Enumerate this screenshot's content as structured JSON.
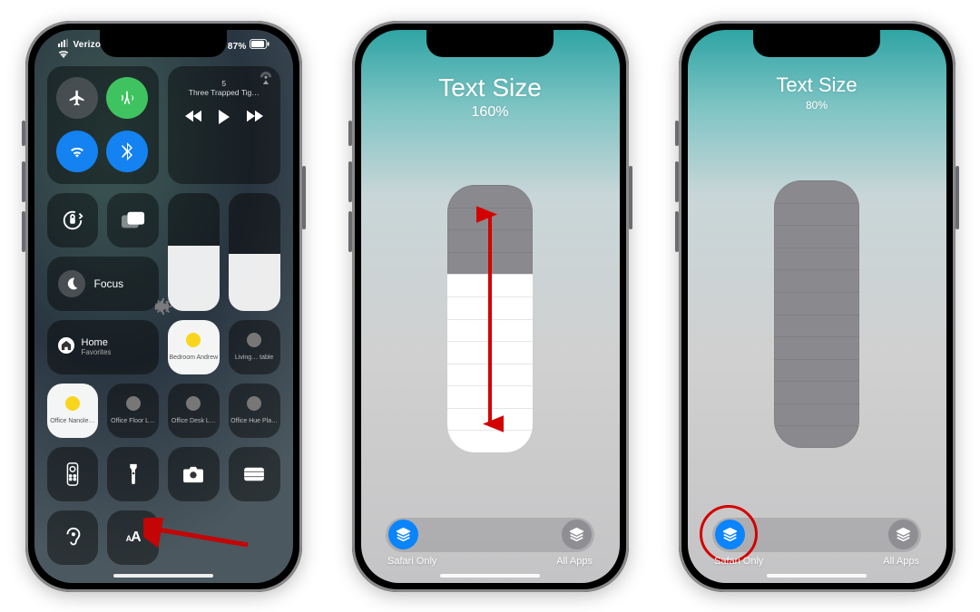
{
  "phones": {
    "controlCenter": {
      "status": {
        "carrier": "Verizon",
        "batteryPercent": "87%"
      },
      "media": {
        "trackNumber": "5",
        "trackTitle": "Three Trapped Tig…"
      },
      "focusLabel": "Focus",
      "home": {
        "title": "Home",
        "subtitle": "Favorites",
        "tiles": [
          {
            "label": "Bedroom Andrew",
            "on": true
          },
          {
            "label": "Living… table",
            "on": false
          },
          {
            "label": "Office Nanole…",
            "on": true,
            "white": true
          },
          {
            "label": "Office Floor L…",
            "on": false
          },
          {
            "label": "Office Desk L…",
            "on": false
          },
          {
            "label": "Office Hue Pla…",
            "on": false
          }
        ]
      },
      "annotation": "arrow-to-text-size"
    },
    "textSizeA": {
      "title": "Text Size",
      "percent": "160%",
      "steps_total": 12,
      "steps_filled": 8,
      "scope": {
        "left": "Safari Only",
        "right": "All Apps",
        "active": "left"
      },
      "annotation": "up-down-arrow"
    },
    "textSizeB": {
      "title": "Text Size",
      "percent": "80%",
      "steps_total": 12,
      "steps_filled": 0,
      "scope": {
        "left": "Safari Only",
        "right": "All Apps",
        "active": "left"
      },
      "annotation": "circle-left-option"
    }
  },
  "iconNames": {
    "airplane": "airplane-icon",
    "cellular": "antenna-icon",
    "wifi": "wifi-icon",
    "bluetooth": "bluetooth-icon",
    "airplay": "airplay-icon",
    "back": "rewind-icon",
    "play": "play-icon",
    "fwd": "fastforward-icon",
    "lock": "rotation-lock-icon",
    "mirror": "screen-mirroring-icon",
    "moon": "moon-icon",
    "sun": "brightness-icon",
    "vol": "volume-icon",
    "remote": "tv-remote-icon",
    "flash": "flashlight-icon",
    "camera": "camera-icon",
    "wallet": "wallet-icon",
    "hearing": "hearing-icon",
    "textsize": "text-size-icon",
    "layers": "layers-icon"
  }
}
